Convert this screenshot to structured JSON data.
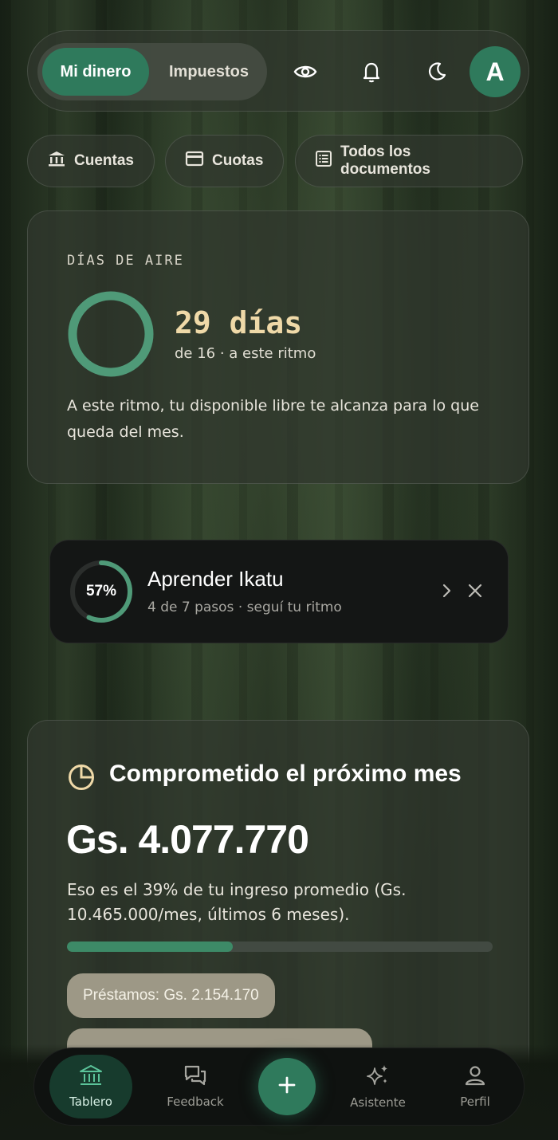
{
  "header": {
    "tabs": [
      {
        "label": "Mi dinero",
        "active": true
      },
      {
        "label": "Impuestos",
        "active": false
      }
    ],
    "icons": [
      "eye-icon",
      "bell-icon",
      "moon-icon"
    ],
    "avatar_initial": "A"
  },
  "quick_links": [
    {
      "label": "Cuentas",
      "icon": "bank-icon"
    },
    {
      "label": "Cuotas",
      "icon": "card-icon"
    },
    {
      "label": "Todos los documentos",
      "icon": "document-list-icon"
    }
  ],
  "air_days": {
    "eyebrow": "DÍAS DE AIRE",
    "value": "29 días",
    "subtitle": "de 16 · a este ritmo",
    "description": "A este ritmo, tu disponible libre te alcanza para lo que queda del mes.",
    "ring_fill": 1.0
  },
  "learn": {
    "percent_label": "57%",
    "progress": 0.57,
    "title": "Aprender Ikatu",
    "subtitle": "4 de 7 pasos · seguí tu ritmo"
  },
  "committed": {
    "title": "Comprometido el próximo mes",
    "amount": "Gs. 4.077.770",
    "description": "Eso es el 39% de tu ingreso promedio (Gs. 10.465.000/mes, últimos 6 meses).",
    "progress": 0.39,
    "chips": [
      "Préstamos: Gs. 2.154.170"
    ]
  },
  "bottom_nav": {
    "items": [
      {
        "label": "Tablero",
        "icon": "bank-icon",
        "active": true
      },
      {
        "label": "Feedback",
        "icon": "chat-icon",
        "active": false
      },
      {
        "label": "Asistente",
        "icon": "sparkles-icon",
        "active": false
      },
      {
        "label": "Perfil",
        "icon": "user-icon",
        "active": false
      }
    ],
    "fab_icon": "plus-icon"
  },
  "colors": {
    "accent": "#2f7a5c",
    "highlight_text": "#efd9a8",
    "chip": "#9d9886"
  }
}
